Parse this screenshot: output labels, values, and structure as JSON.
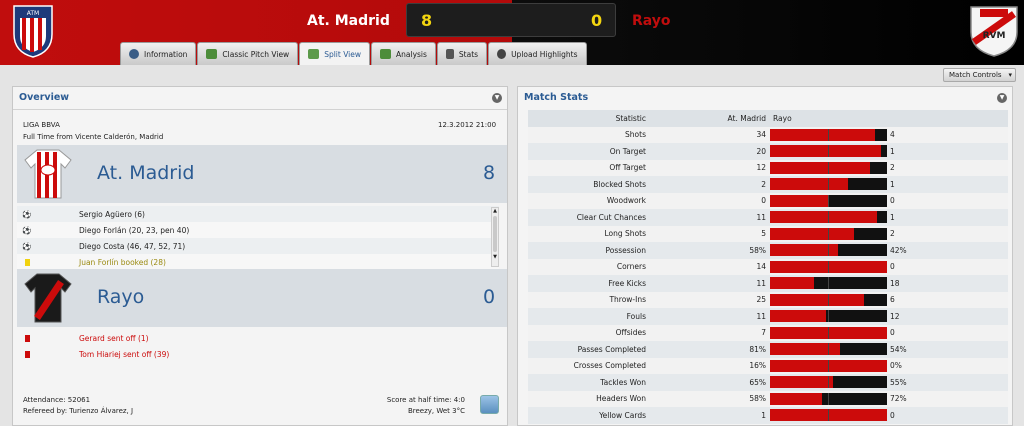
{
  "header": {
    "home_team": "At. Madrid",
    "away_team": "Rayo",
    "home_score": "8",
    "away_score": "0",
    "home_crest_letters": "ATM",
    "away_crest_letters": "RVM"
  },
  "tabs": [
    {
      "label": "Information",
      "icon": "info-icon"
    },
    {
      "label": "Classic Pitch View",
      "icon": "pitch-icon"
    },
    {
      "label": "Split View",
      "icon": "split-view-icon"
    },
    {
      "label": "Analysis",
      "icon": "analysis-icon"
    },
    {
      "label": "Stats",
      "icon": "stats-icon"
    },
    {
      "label": "Upload Highlights",
      "icon": "upload-icon"
    }
  ],
  "match_controls_label": "Match Controls",
  "overview": {
    "title": "Overview",
    "competition": "LIGA BBVA",
    "venue": "Full Time from Vicente Calderón, Madrid",
    "datetime": "12.3.2012 21:00",
    "home": {
      "name": "At. Madrid",
      "score": "8",
      "events": [
        {
          "type": "goal",
          "text": "Sergio Agüero (6)"
        },
        {
          "type": "goal",
          "text": "Diego Forlán (20, 23, pen 40)"
        },
        {
          "type": "goal",
          "text": "Diego Costa (46, 47, 52, 71)"
        },
        {
          "type": "yellow",
          "text": "Juan Forlín booked (28)"
        }
      ]
    },
    "away": {
      "name": "Rayo",
      "score": "0",
      "events": [
        {
          "type": "red",
          "text": "Gerard sent off (1)"
        },
        {
          "type": "red",
          "text": "Tom Hiariej sent off (39)"
        }
      ]
    },
    "footer": {
      "attendance": "Attendance: 52061",
      "referee": "Refereed by: Turienzo Álvarez, J",
      "halftime": "Score at half time: 4:0",
      "weather": "Breezy, Wet 3°C"
    }
  },
  "match_stats": {
    "title": "Match Stats",
    "col_statistic": "Statistic",
    "col_home": "At. Madrid",
    "col_away": "Rayo",
    "rows": [
      {
        "name": "Shots",
        "home": "34",
        "away": "4",
        "ratio": 0.895
      },
      {
        "name": "On Target",
        "home": "20",
        "away": "1",
        "ratio": 0.952
      },
      {
        "name": "Off Target",
        "home": "12",
        "away": "2",
        "ratio": 0.857
      },
      {
        "name": "Blocked Shots",
        "home": "2",
        "away": "1",
        "ratio": 0.667
      },
      {
        "name": "Woodwork",
        "home": "0",
        "away": "0",
        "ratio": 0.5
      },
      {
        "name": "Clear Cut Chances",
        "home": "11",
        "away": "1",
        "ratio": 0.917
      },
      {
        "name": "Long Shots",
        "home": "5",
        "away": "2",
        "ratio": 0.714
      },
      {
        "name": "Possession",
        "home": "58%",
        "away": "42%",
        "ratio": 0.58
      },
      {
        "name": "Corners",
        "home": "14",
        "away": "0",
        "ratio": 1.0
      },
      {
        "name": "Free Kicks",
        "home": "11",
        "away": "18",
        "ratio": 0.379
      },
      {
        "name": "Throw-Ins",
        "home": "25",
        "away": "6",
        "ratio": 0.806
      },
      {
        "name": "Fouls",
        "home": "11",
        "away": "12",
        "ratio": 0.478
      },
      {
        "name": "Offsides",
        "home": "7",
        "away": "0",
        "ratio": 1.0
      },
      {
        "name": "Passes Completed",
        "home": "81%",
        "away": "54%",
        "ratio": 0.6
      },
      {
        "name": "Crosses Completed",
        "home": "16%",
        "away": "0%",
        "ratio": 1.0
      },
      {
        "name": "Tackles Won",
        "home": "65%",
        "away": "55%",
        "ratio": 0.542
      },
      {
        "name": "Headers Won",
        "home": "58%",
        "away": "72%",
        "ratio": 0.446
      },
      {
        "name": "Yellow Cards",
        "home": "1",
        "away": "0",
        "ratio": 1.0
      }
    ]
  },
  "colors": {
    "home_red": "#cc0b0b",
    "away_black": "#111111",
    "score_yellow": "#f3d510",
    "title_blue": "#2b5b93"
  }
}
